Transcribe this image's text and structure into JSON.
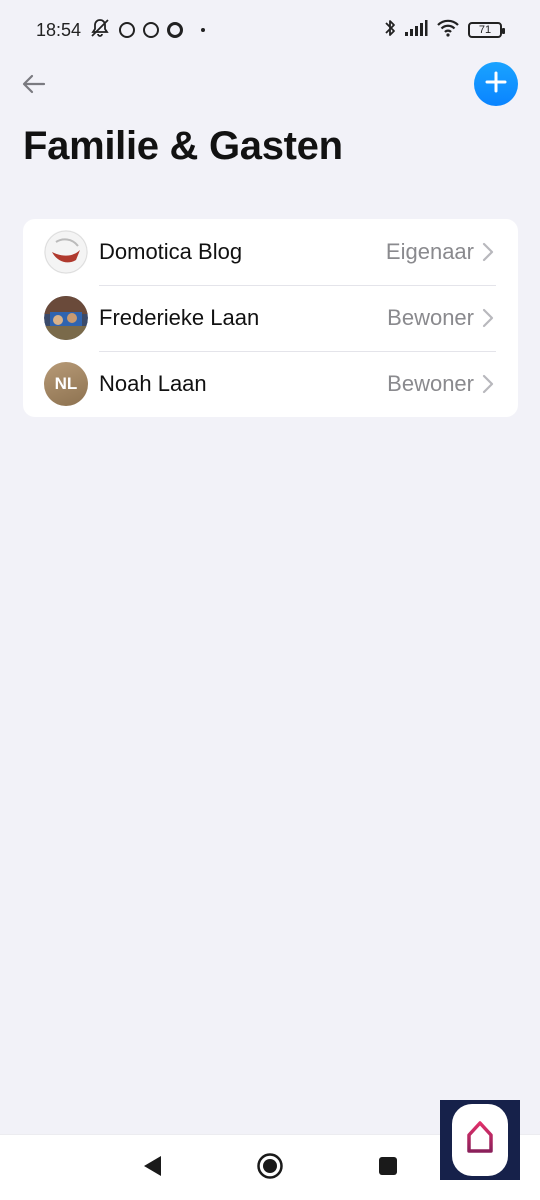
{
  "status_bar": {
    "time": "18:54",
    "battery": "71"
  },
  "header": {
    "title": "Familie & Gasten",
    "back_icon": "arrow-left-icon",
    "add_icon": "plus-icon",
    "accent_color": "#0a84ff"
  },
  "members": [
    {
      "name": "Domotica Blog",
      "role": "Eigenaar",
      "avatar": "photo"
    },
    {
      "name": "Frederieke Laan",
      "role": "Bewoner",
      "avatar": "photo"
    },
    {
      "name": "Noah Laan",
      "role": "Bewoner",
      "avatar_initials": "NL"
    }
  ],
  "navigation": {
    "back_icon": "triangle-back-icon",
    "home_icon": "circle-home-icon",
    "recents_icon": "square-recents-icon"
  },
  "app_badge": {
    "icon": "house-logo-icon"
  }
}
